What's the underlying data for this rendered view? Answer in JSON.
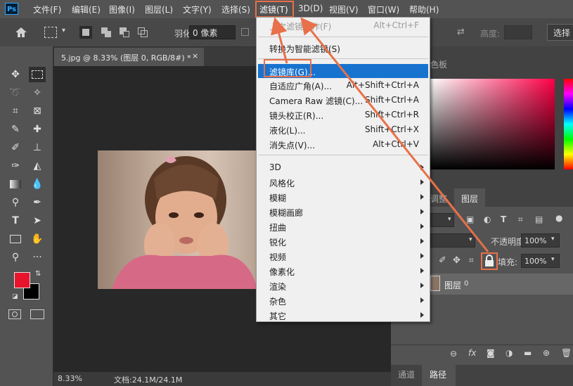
{
  "menubar": {
    "items": [
      "文件(F)",
      "编辑(E)",
      "图像(I)",
      "图层(L)",
      "文字(Y)",
      "选择(S)",
      "滤镜(T)",
      "3D(D)",
      "视图(V)",
      "窗口(W)",
      "帮助(H)"
    ],
    "logo": "Ps"
  },
  "options": {
    "feather_label": "羽化:",
    "feather_value": "0 像素",
    "height_label": "高度:",
    "select_label": "选择"
  },
  "document": {
    "tab_label": "5.jpg @ 8.33% (图层 0, RGB/8#) *",
    "close_glyph": "×"
  },
  "status": {
    "zoom": "8.33%",
    "doc_info": "文档:24.1M/24.1M"
  },
  "filter_menu": {
    "last_filter": {
      "label": "上次滤镜操作(F)",
      "shortcut": "Alt+Ctrl+F"
    },
    "convert": "转换为智能滤镜(S)",
    "gallery": "滤镜库(G)...",
    "group1": [
      {
        "label": "自适应广角(A)...",
        "shortcut": "Alt+Shift+Ctrl+A"
      },
      {
        "label": "Camera Raw 滤镜(C)...",
        "shortcut": "Shift+Ctrl+A"
      },
      {
        "label": "镜头校正(R)...",
        "shortcut": "Shift+Ctrl+R"
      },
      {
        "label": "液化(L)...",
        "shortcut": "Shift+Ctrl+X"
      },
      {
        "label": "消失点(V)...",
        "shortcut": "Alt+Ctrl+V"
      }
    ],
    "submenus": [
      "3D",
      "风格化",
      "模糊",
      "模糊画廊",
      "扭曲",
      "锐化",
      "视频",
      "像素化",
      "渲染",
      "杂色",
      "其它"
    ]
  },
  "panels": {
    "color_tab": "色板",
    "adjust_tab": "调整",
    "layers_tab": "图层",
    "opacity_label": "不透明度:",
    "opacity_value": "100%",
    "fill_label": "填充:",
    "fill_value": "100%",
    "layer_name": "图层",
    "layer_num": "0",
    "bottom_tab_channels": "通道",
    "bottom_tab_paths": "路径"
  },
  "colors": {
    "foreground": "#e8142c",
    "background": "#000000",
    "highlight": "#1873cf",
    "annotation": "#e8704a"
  }
}
